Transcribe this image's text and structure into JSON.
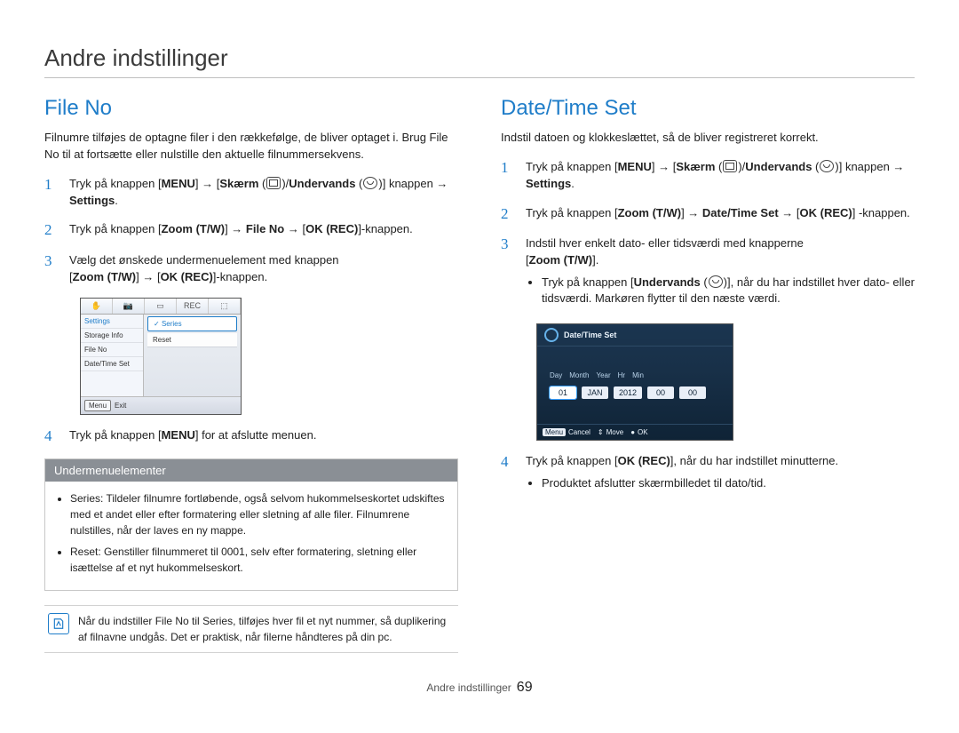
{
  "page_title": "Andre indstillinger",
  "page_number": "69",
  "footer_label": "Andre indstillinger",
  "left": {
    "heading": "File No",
    "intro": "Filnumre tilføjes de optagne filer i den rækkefølge, de bliver optaget i. Brug File No til at fortsætte eller nulstille den aktuelle filnummersekvens.",
    "steps": {
      "1": {
        "prefix": "Tryk på knappen [",
        "menu": "MENU",
        "mid1": "] → [",
        "skaerm": "Skærm",
        "mid2": " (",
        "mid3": ")/",
        "undervands": "Undervands",
        "mid4": " (",
        "mid5": ")] knappen → ",
        "settings": "Settings",
        "end": "."
      },
      "2": {
        "prefix": "Tryk på knappen [",
        "zoom": "Zoom (T/W)",
        "mid1": "] → ",
        "fileno": "File No",
        "mid2": " → [",
        "okrec": "OK (REC)",
        "end": "]-knappen."
      },
      "3": {
        "line1": "Vælg det ønskede undermenuelement med knappen ",
        "zoom_open": "[",
        "zoom": "Zoom (T/W)",
        "zoom_close": "] → [",
        "okrec": "OK (REC)",
        "end": "]-knappen."
      },
      "4": {
        "prefix": "Tryk på knappen [",
        "menu": "MENU",
        "end": "] for at afslutte menuen."
      }
    },
    "camshot": {
      "tabs": [
        "✋",
        "📷",
        "▭",
        "REC",
        "⬚"
      ],
      "left_items": [
        "Settings",
        "Storage Info",
        "File No",
        "Date/Time Set"
      ],
      "left_selected_index": 0,
      "options": [
        "Series",
        "Reset"
      ],
      "option_selected_index": 0,
      "footer_menu": "Menu",
      "footer_exit": "Exit"
    },
    "submenu": {
      "heading": "Undermenuelementer",
      "items": [
        {
          "name": "Series",
          "desc": ": Tildeler filnumre fortløbende, også selvom hukommelseskortet udskiftes med et andet eller efter formatering eller sletning af alle filer. Filnumrene nulstilles, når der laves en ny mappe."
        },
        {
          "name": "Reset",
          "desc": ": Genstiller filnummeret til 0001, selv efter formatering, sletning eller isættelse af et nyt hukommelseskort."
        }
      ]
    },
    "note": {
      "prefix": "Når du indstiller ",
      "fileno": "File No",
      "mid1": " til ",
      "series": "Series",
      "rest": ", tilføjes hver fil et nyt nummer, så duplikering af filnavne undgås. Det er praktisk, når filerne håndteres på din pc."
    }
  },
  "right": {
    "heading": "Date/Time Set",
    "intro": "Indstil datoen og klokkeslættet, så de bliver registreret korrekt.",
    "steps": {
      "1": {
        "prefix": "Tryk på knappen [",
        "menu": "MENU",
        "mid1": "] → [",
        "skaerm": "Skærm",
        "mid2": " (",
        "mid3": ")/",
        "undervands": "Undervands",
        "mid4": " (",
        "mid5": ")] knappen → ",
        "settings": "Settings",
        "end": "."
      },
      "2": {
        "prefix": "Tryk på knappen [",
        "zoom": "Zoom (T/W)",
        "mid1": "] → ",
        "dts": "Date/Time Set",
        "mid2": " → [",
        "okrec": "OK (REC)",
        "end": "] -knappen."
      },
      "3": {
        "line1": "Indstil hver enkelt dato- eller tidsværdi med knapperne ",
        "zoom_open": "[",
        "zoom": "Zoom (T/W)",
        "zoom_close": "].",
        "sub_prefix": "Tryk på knappen [",
        "undervands": "Undervands",
        "sub_mid": " (",
        "sub_mid2": ")], når du har indstillet hver dato- eller tidsværdi. Markøren flytter til den næste værdi."
      },
      "4": {
        "prefix": "Tryk på knappen [",
        "okrec": "OK (REC)",
        "end": "], når du har indstillet minutterne.",
        "sub": "Produktet afslutter skærmbilledet til dato/tid."
      }
    },
    "camshot": {
      "title": "Date/Time Set",
      "labels": [
        "Day",
        "Month",
        "Year",
        "Hr",
        "Min"
      ],
      "values": [
        "01",
        "JAN",
        "2012",
        "00",
        "00"
      ],
      "selected_index": 0,
      "footer": {
        "menu": "Menu",
        "cancel": "Cancel",
        "move": "Move",
        "ok": "OK"
      }
    }
  }
}
